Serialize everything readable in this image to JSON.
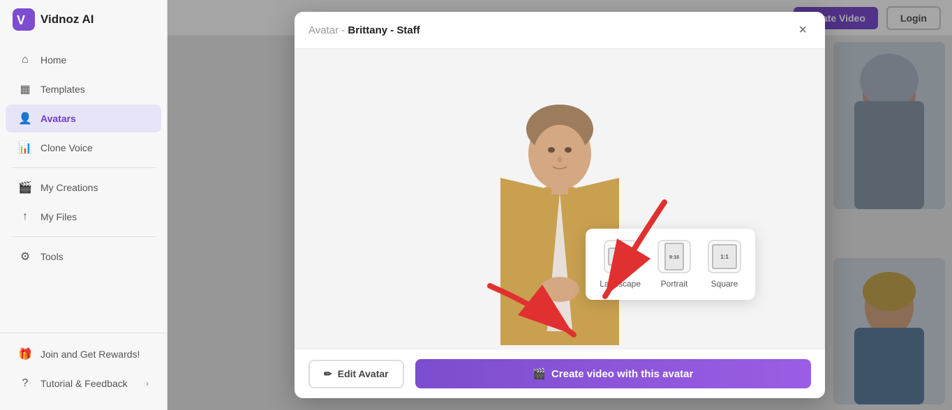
{
  "app": {
    "logo_text": "Vidnoz AI",
    "logo_icon": "V"
  },
  "sidebar": {
    "nav_items": [
      {
        "id": "home",
        "label": "Home",
        "icon": "home"
      },
      {
        "id": "templates",
        "label": "Templates",
        "icon": "templates"
      },
      {
        "id": "avatars",
        "label": "Avatars",
        "icon": "avatars",
        "active": true
      },
      {
        "id": "clone-voice",
        "label": "Clone Voice",
        "icon": "clone-voice"
      }
    ],
    "nav_items2": [
      {
        "id": "my-creations",
        "label": "My Creations",
        "icon": "my-creations"
      },
      {
        "id": "my-files",
        "label": "My Files",
        "icon": "my-files"
      }
    ],
    "nav_items3": [
      {
        "id": "tools",
        "label": "Tools",
        "icon": "tools"
      }
    ],
    "bottom_items": [
      {
        "id": "join-rewards",
        "label": "Join and Get Rewards!",
        "icon": "gift",
        "has_dot": true
      },
      {
        "id": "tutorial-feedback",
        "label": "Tutorial & Feedback",
        "icon": "help",
        "has_arrow": true
      }
    ]
  },
  "topbar": {
    "create_video_label": "Create Video",
    "login_label": "Login"
  },
  "modal": {
    "breadcrumb_avatar": "Avatar -",
    "avatar_name": "Brittany - Staff",
    "close_label": "×",
    "orientation_options": [
      {
        "id": "landscape",
        "label": "Landscape",
        "ratio": "16:9"
      },
      {
        "id": "portrait",
        "label": "Portrait",
        "ratio": "9:16"
      },
      {
        "id": "square",
        "label": "Square",
        "ratio": "1:1"
      }
    ],
    "edit_avatar_label": "Edit Avatar",
    "create_video_label": "Create video with this avatar"
  }
}
